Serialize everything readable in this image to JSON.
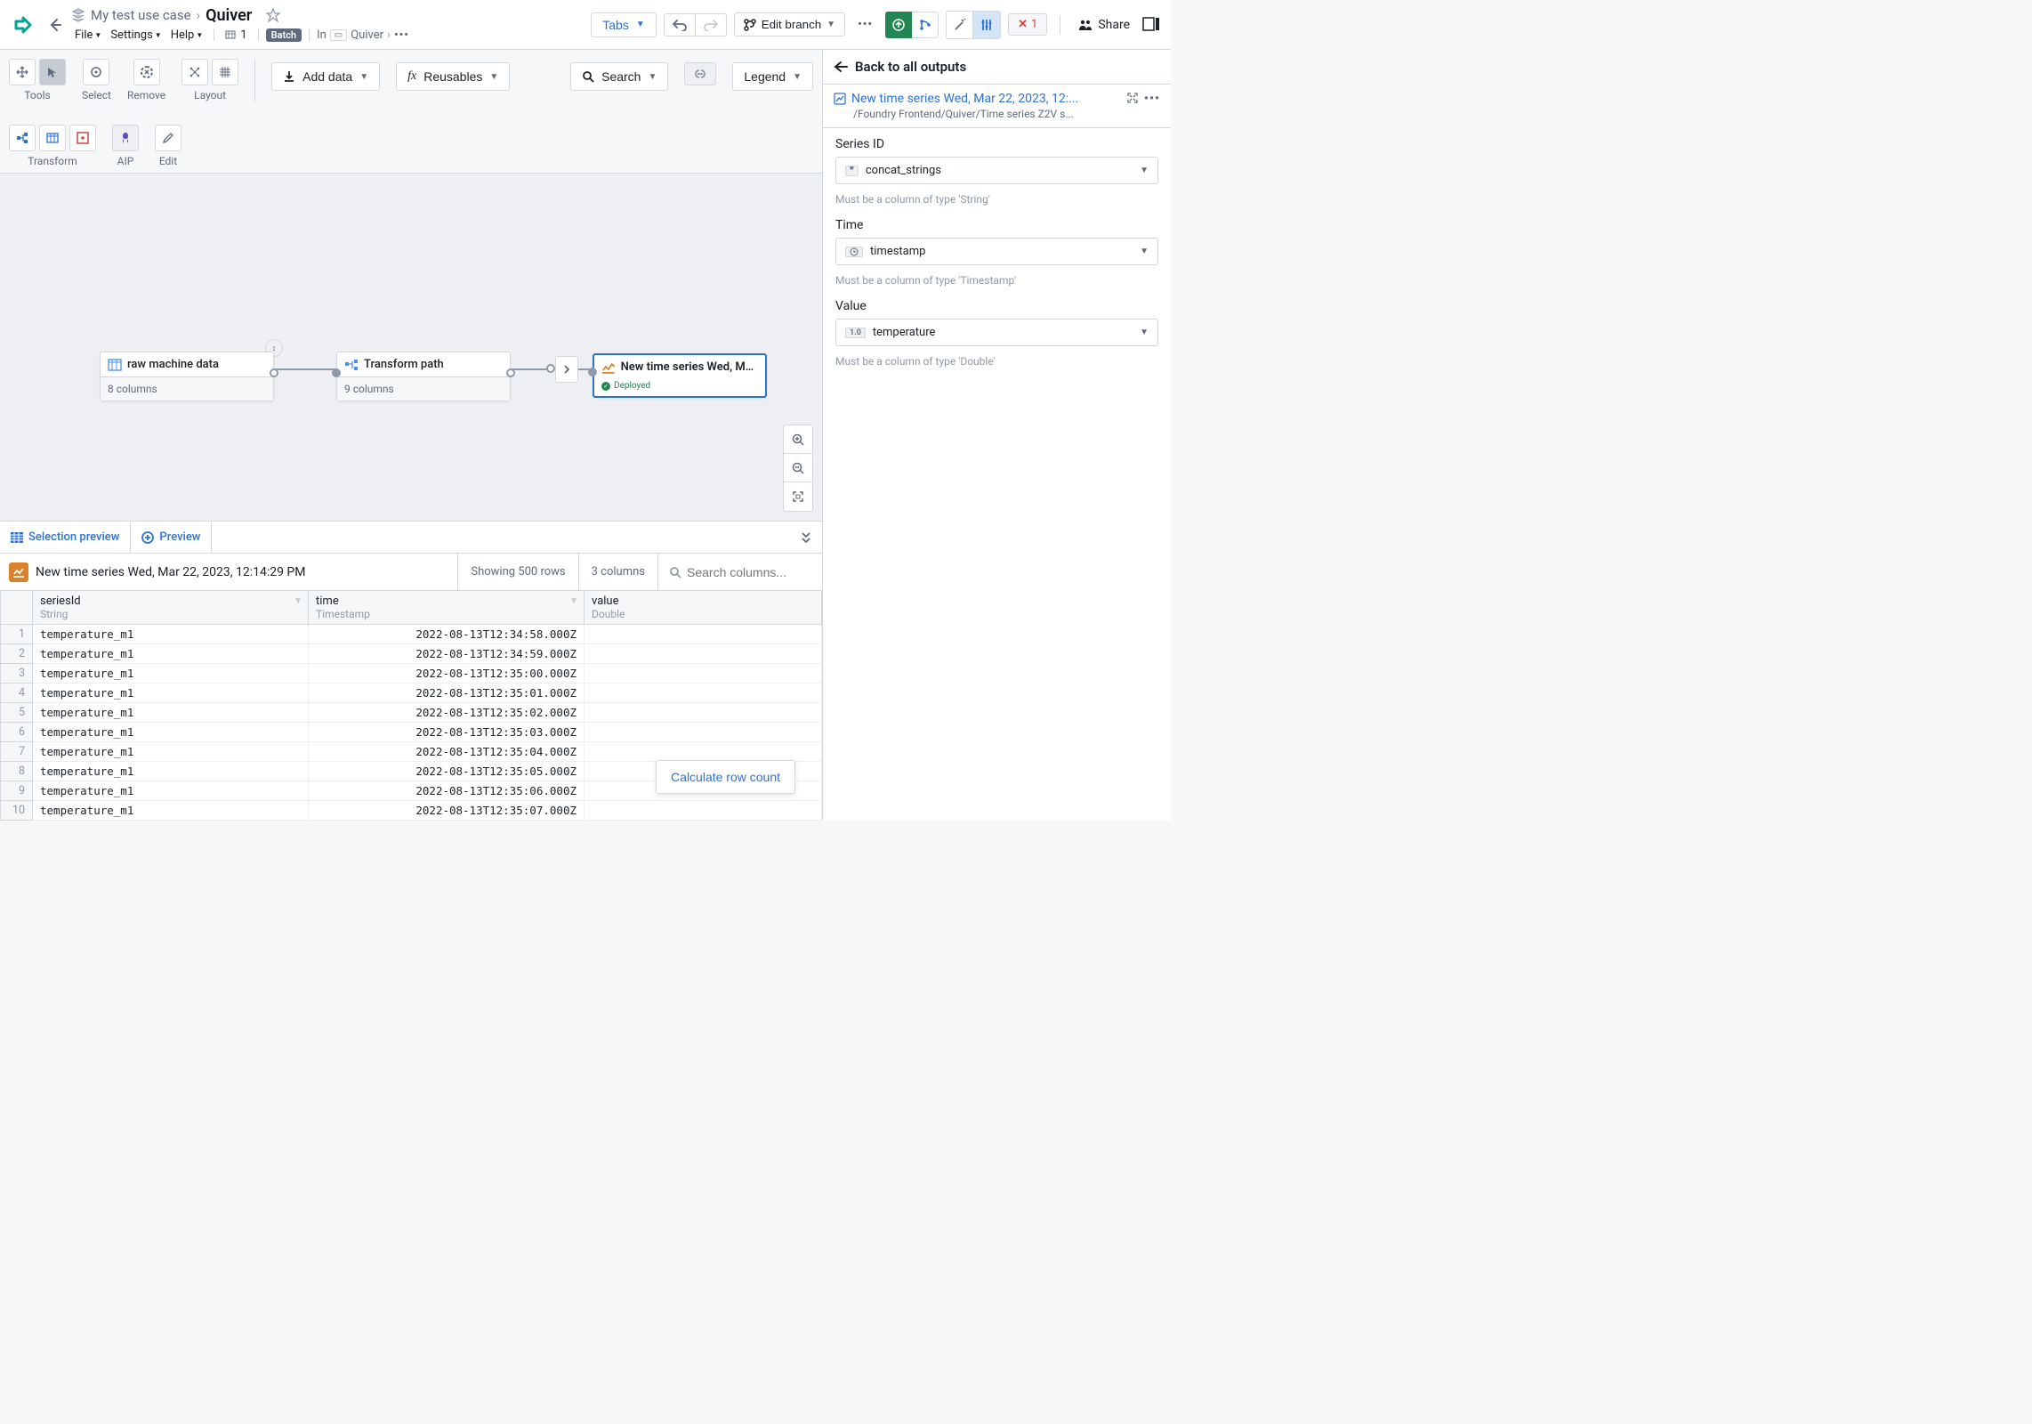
{
  "header": {
    "project": "My test use case",
    "title": "Quiver",
    "menu": {
      "file": "File",
      "settings": "Settings",
      "help": "Help"
    },
    "count": "1",
    "batch": "Batch",
    "in": "In",
    "path": "Quiver"
  },
  "topbar": {
    "tabs": "Tabs",
    "edit_branch": "Edit branch",
    "error_count": "1",
    "share": "Share"
  },
  "toolbar": {
    "tools": "Tools",
    "select": "Select",
    "remove": "Remove",
    "layout": "Layout",
    "add_data": "Add data",
    "reusables": "Reusables",
    "search": "Search",
    "legend": "Legend",
    "transform": "Transform",
    "aip": "AIP",
    "edit": "Edit"
  },
  "canvas": {
    "node1": {
      "title": "raw machine data",
      "sub": "8 columns"
    },
    "node2": {
      "title": "Transform path",
      "sub": "9 columns"
    },
    "node3": {
      "title": "New time series Wed, Ma...",
      "deployed": "Deployed"
    }
  },
  "preview": {
    "tab_selection": "Selection preview",
    "tab_preview": "Preview",
    "title": "New time series Wed, Mar 22, 2023, 12:14:29 PM",
    "rows": "Showing 500 rows",
    "cols": "3 columns",
    "search_placeholder": "Search columns...",
    "calc": "Calculate row count",
    "columns": [
      {
        "name": "seriesId",
        "type": "String"
      },
      {
        "name": "time",
        "type": "Timestamp"
      },
      {
        "name": "value",
        "type": "Double"
      }
    ],
    "data": [
      {
        "s": "temperature_m1",
        "t": "2022-08-13T12:34:58.000Z",
        "v": ""
      },
      {
        "s": "temperature_m1",
        "t": "2022-08-13T12:34:59.000Z",
        "v": ""
      },
      {
        "s": "temperature_m1",
        "t": "2022-08-13T12:35:00.000Z",
        "v": ""
      },
      {
        "s": "temperature_m1",
        "t": "2022-08-13T12:35:01.000Z",
        "v": ""
      },
      {
        "s": "temperature_m1",
        "t": "2022-08-13T12:35:02.000Z",
        "v": ""
      },
      {
        "s": "temperature_m1",
        "t": "2022-08-13T12:35:03.000Z",
        "v": ""
      },
      {
        "s": "temperature_m1",
        "t": "2022-08-13T12:35:04.000Z",
        "v": ""
      },
      {
        "s": "temperature_m1",
        "t": "2022-08-13T12:35:05.000Z",
        "v": ""
      },
      {
        "s": "temperature_m1",
        "t": "2022-08-13T12:35:06.000Z",
        "v": ""
      },
      {
        "s": "temperature_m1",
        "t": "2022-08-13T12:35:07.000Z",
        "v": ""
      }
    ]
  },
  "right": {
    "back": "Back to all outputs",
    "node_title": "New time series Wed, Mar 22, 2023, 12:...",
    "node_path": "/Foundry Frontend/Quiver/Time series Z2V s...",
    "series_label": "Series ID",
    "series_value": "concat_strings",
    "series_hint": "Must be a column of type 'String'",
    "time_label": "Time",
    "time_value": "timestamp",
    "time_hint": "Must be a column of type 'Timestamp'",
    "value_label": "Value",
    "value_value": "temperature",
    "value_hint": "Must be a column of type 'Double'",
    "type_str": "\"\"",
    "type_ts": "⏱",
    "type_num": "1.0"
  }
}
